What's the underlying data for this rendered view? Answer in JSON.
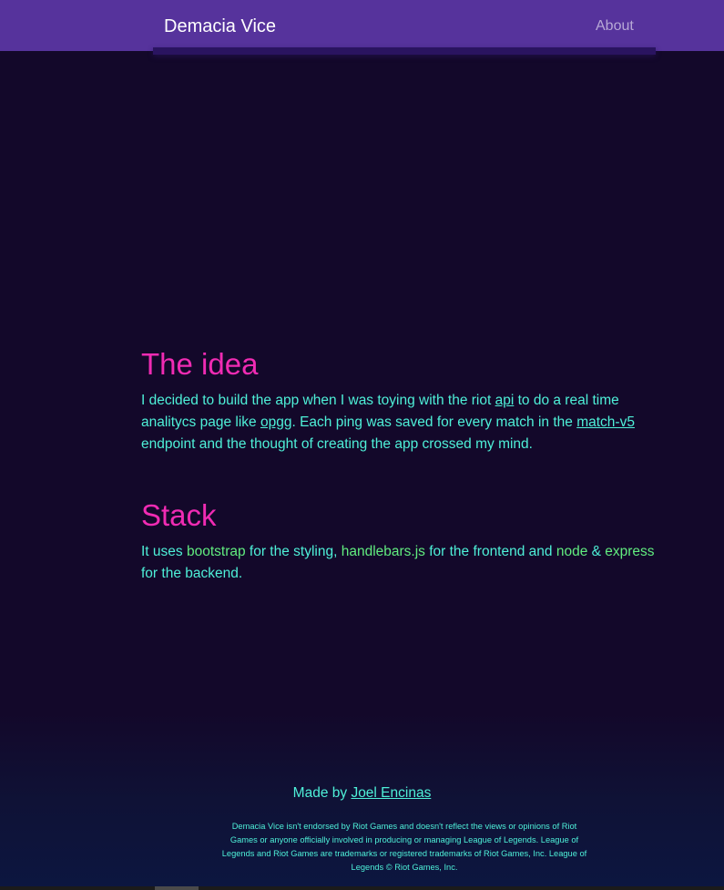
{
  "navbar": {
    "brand": "Demacia Vice",
    "about_label": "About"
  },
  "idea": {
    "heading": "The idea",
    "text1": "I decided to build the app when I was toying with the riot ",
    "link_api": "api",
    "text2": " to do a real time analitycs page like ",
    "link_opgg": "opgg",
    "text3": ". Each ping was saved for every match in the ",
    "link_match": "match-v5",
    "text4": " endpoint and the thought of creating the app crossed my mind."
  },
  "stack": {
    "heading": "Stack",
    "text1": "It uses ",
    "bootstrap": "bootstrap",
    "text2": " for the styling, ",
    "handlebars": "handlebars.js",
    "text3": " for the frontend and ",
    "node": "node",
    "text4": " & ",
    "express": "express",
    "text5": " for the backend."
  },
  "footer": {
    "made_by": "Made by ",
    "author": "Joel Encinas",
    "disclaimer": "Demacia Vice isn't endorsed by Riot Games and doesn't reflect the views or opinions of Riot Games or anyone officially involved in producing or managing League of Legends. League of Legends and Riot Games are trademarks or registered trademarks of Riot Games, Inc. League of Legends © Riot Games, Inc."
  },
  "colors": {
    "navbar": "#56339c",
    "background": "#13082a",
    "heading": "#f02bb3",
    "body_text": "#4ef0d8",
    "tech_highlight": "#61ec7f"
  }
}
